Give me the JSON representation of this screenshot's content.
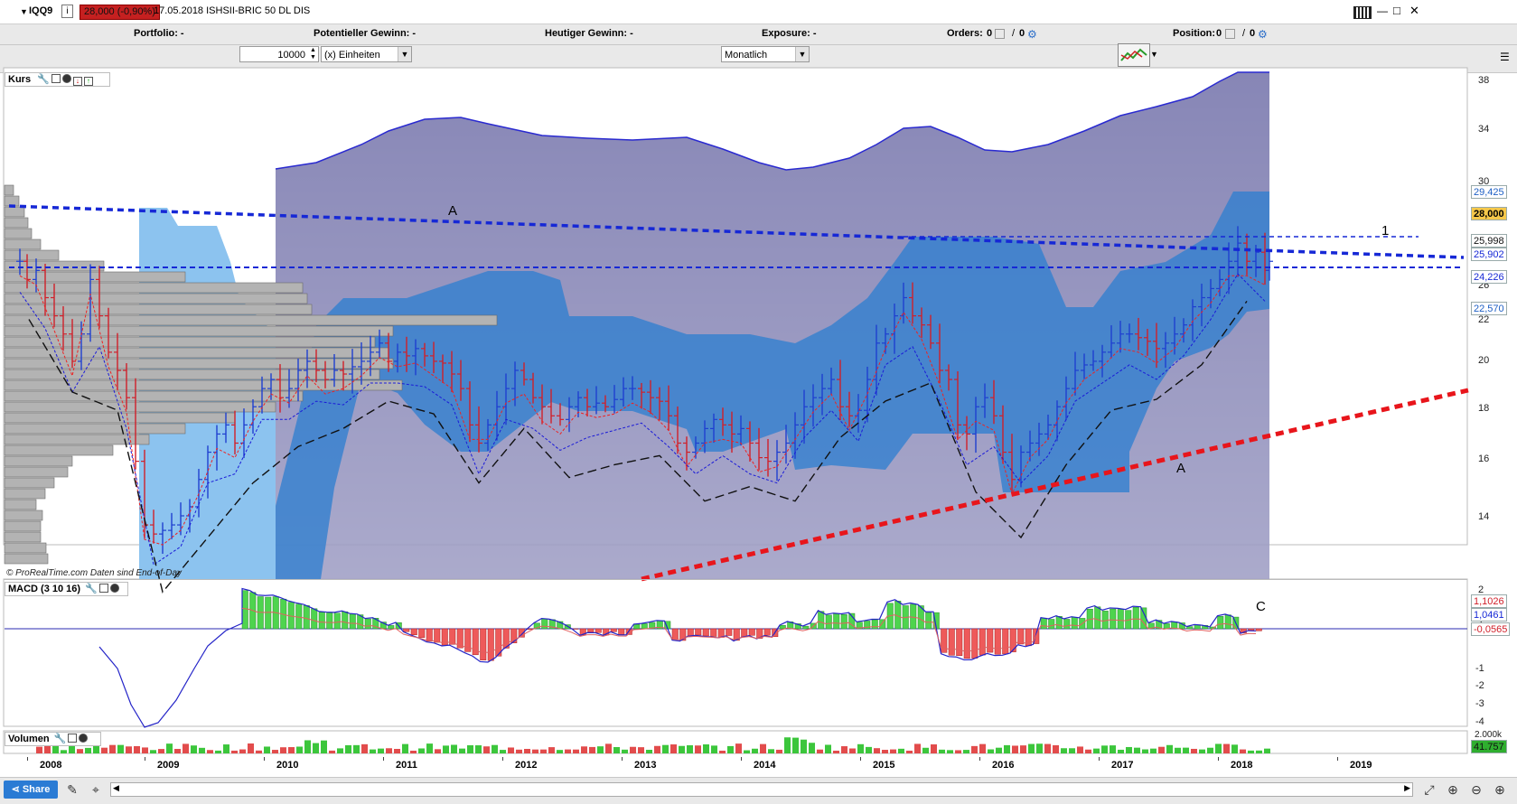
{
  "titlebar": {
    "symbol": "IQQ9",
    "info_icon": "i",
    "price_change": "28,000 (-0,90%)",
    "date_name": "17.05.2018 ISHSII-BRIC 50 DL DIS",
    "window_buttons": [
      "—",
      "□",
      "✕"
    ]
  },
  "infobar": {
    "portfolio": "Portfolio: -",
    "potential_gain": "Potentieller Gewinn: -",
    "today_gain": "Heutiger Gewinn: -",
    "exposure": "Exposure: -",
    "orders_label": "Orders:",
    "orders_a": "0",
    "orders_b": "0",
    "position_label": "Position:",
    "position_a": "0",
    "position_b": "0"
  },
  "controls": {
    "quantity": "10000",
    "unit": "(x) Einheiten",
    "period": "Monatlich"
  },
  "price_panel": {
    "label": "Kurs",
    "watermark": "© ProRealTime.com  Daten sind End-of-Day",
    "annotations": {
      "a1": "A",
      "a2": "A",
      "one": "1"
    },
    "y_ticks": [
      "38",
      "34",
      "30",
      "26",
      "22",
      "20",
      "18",
      "16",
      "14"
    ],
    "badges": {
      "b1": "29,425",
      "b2": "28,000",
      "b3": "25,998",
      "b4": "25,902",
      "b5": "24,226",
      "b6": "22,570"
    }
  },
  "macd_panel": {
    "label": "MACD (3 10 16)",
    "annotation": "C",
    "y_ticks": [
      "2",
      "1",
      "-1",
      "-2",
      "-3",
      "-4"
    ],
    "badges": {
      "b1": "1,1026",
      "b2": "1,0461",
      "b3": "-0,0565"
    }
  },
  "volume_panel": {
    "label": "Volumen",
    "top_tick": "2.000k",
    "badge": "41.757"
  },
  "x_axis": {
    "years": [
      "2008",
      "2009",
      "2010",
      "2011",
      "2012",
      "2013",
      "2014",
      "2015",
      "2016",
      "2017",
      "2018",
      "2019"
    ]
  },
  "bottombar": {
    "share": "Share"
  },
  "colors": {
    "cloud_dark": "#6c6ba6",
    "cloud_blue": "#2f7fd0",
    "cloud_light": "#8cc3ef",
    "up": "#1f3fd0",
    "down": "#d0202a",
    "trend_red": "#e8151b",
    "trend_blue": "#1628d6"
  }
}
